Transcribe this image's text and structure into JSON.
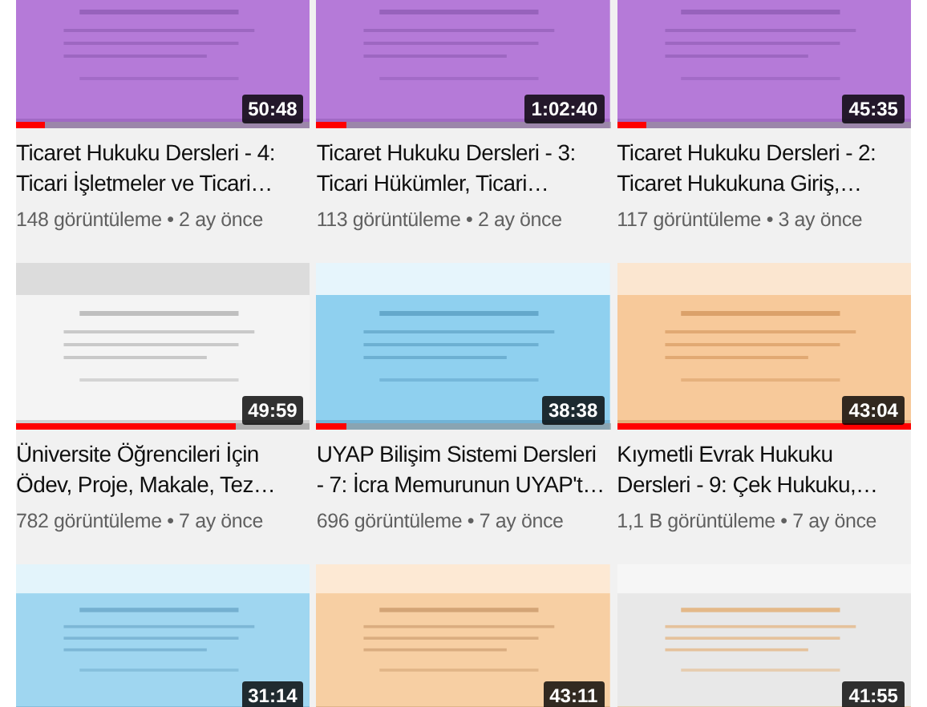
{
  "videos": [
    {
      "kind": "picture",
      "duration": "50:48",
      "level": 0.1,
      "title_lines": [
        "Ticaret Hukuku Dersleri - 4:",
        "Ticari İşletmeler ve Ticari…"
      ],
      "meta": "148 görüntüleme • 2 ay önce"
    },
    {
      "kind": "picture",
      "duration": "1:02:40",
      "level": 0.1,
      "title_lines": [
        "Ticaret Hukuku Dersleri - 3:",
        "Ticari Hükümler, Ticari…"
      ],
      "meta": "113 görüntüleme • 2 ay önce"
    },
    {
      "kind": "picture",
      "duration": "45:35",
      "level": 0.1,
      "title_lines": [
        "Ticaret Hukuku Dersleri - 2:",
        "Ticaret Hukukuna Giriş,…"
      ],
      "meta": "117 görüntüleme • 3 ay önce"
    },
    {
      "kind": "picture",
      "duration": "49:59",
      "level": 0.75,
      "title_lines": [
        "Üniversite Öğrencileri İçin",
        "Ödev, Proje, Makale, Tez…"
      ],
      "meta": "782 görüntüleme • 7 ay önce"
    },
    {
      "kind": "picture",
      "duration": "38:38",
      "level": 0.1,
      "title_lines": [
        "UYAP Bilişim Sistemi Dersleri",
        "- 7: İcra Memurunun UYAP't…"
      ],
      "meta": "696 görüntüleme • 7 ay önce"
    },
    {
      "kind": "picture",
      "duration": "43:04",
      "level": 1,
      "title_lines": [
        "Kıymetli Evrak Hukuku",
        "Dersleri - 9: Çek Hukuku,…"
      ],
      "meta": "1,1 B görüntüleme • 7 ay önce"
    },
    {
      "kind": "picture",
      "duration": "31:14"
    },
    {
      "kind": "picture",
      "duration": "43:11"
    },
    {
      "kind": "picture",
      "duration": "41:55"
    }
  ]
}
